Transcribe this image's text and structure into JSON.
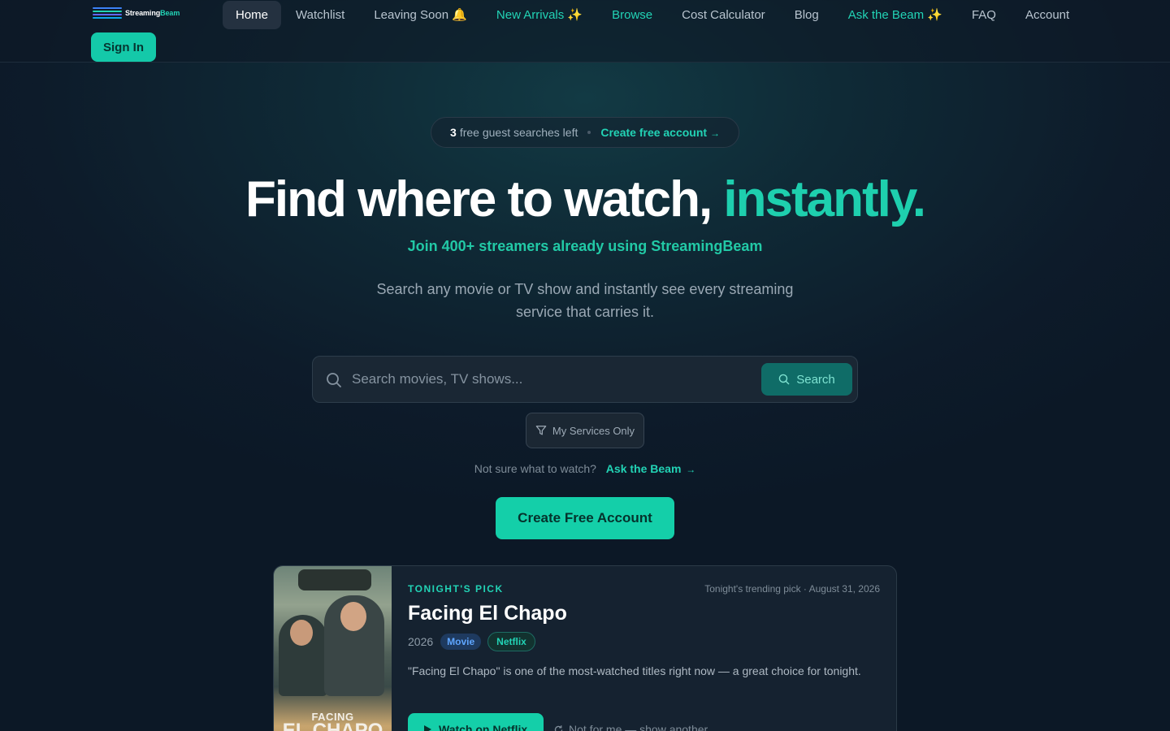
{
  "brand": {
    "name_part1": "Streaming",
    "name_part2": "Beam"
  },
  "nav": {
    "items": [
      {
        "label": "Home",
        "active": true,
        "accent": false
      },
      {
        "label": "Watchlist",
        "active": false,
        "accent": false
      },
      {
        "label": "Leaving Soon 🔔",
        "active": false,
        "accent": false
      },
      {
        "label": "New Arrivals ✨",
        "active": false,
        "accent": true
      },
      {
        "label": "Browse",
        "active": false,
        "accent": true
      },
      {
        "label": "Cost Calculator",
        "active": false,
        "accent": false
      },
      {
        "label": "Blog",
        "active": false,
        "accent": false
      },
      {
        "label": "Ask the Beam ✨",
        "active": false,
        "accent": true
      },
      {
        "label": "FAQ",
        "active": false,
        "accent": false
      },
      {
        "label": "Account",
        "active": false,
        "accent": false
      }
    ],
    "sign_in": "Sign In"
  },
  "guest": {
    "count": "3",
    "text": "free guest searches left",
    "link": "Create free account",
    "arrow": "→"
  },
  "hero": {
    "headline_main": "Find where to watch,",
    "headline_highlight": "instantly.",
    "join": "Join 400+ streamers already using StreamingBeam",
    "sub": "Search any movie or TV show and instantly see every streaming service that carries it."
  },
  "search": {
    "placeholder": "Search movies, TV shows...",
    "button": "Search",
    "filter": "My Services Only"
  },
  "helper": {
    "prompt": "Not sure what to watch?",
    "link": "Ask the Beam",
    "arrow": "→"
  },
  "cta": "Create Free Account",
  "pick": {
    "label": "TONIGHT'S PICK",
    "trend": "Tonight's trending pick · August 31, 2026",
    "title": "Facing El Chapo",
    "year": "2026",
    "type": "Movie",
    "service": "Netflix",
    "description": "\"Facing El Chapo\" is one of the most-watched titles right now — a great choice for tonight.",
    "watch": "Watch on Netflix",
    "another": "Not for me — show another",
    "poster_title_top": "FACING",
    "poster_title_bottom": "EL CHAPO"
  },
  "colors": {
    "accent": "#22d3b5",
    "background": "#0d1b2a",
    "primary_button": "#14cfa9"
  }
}
